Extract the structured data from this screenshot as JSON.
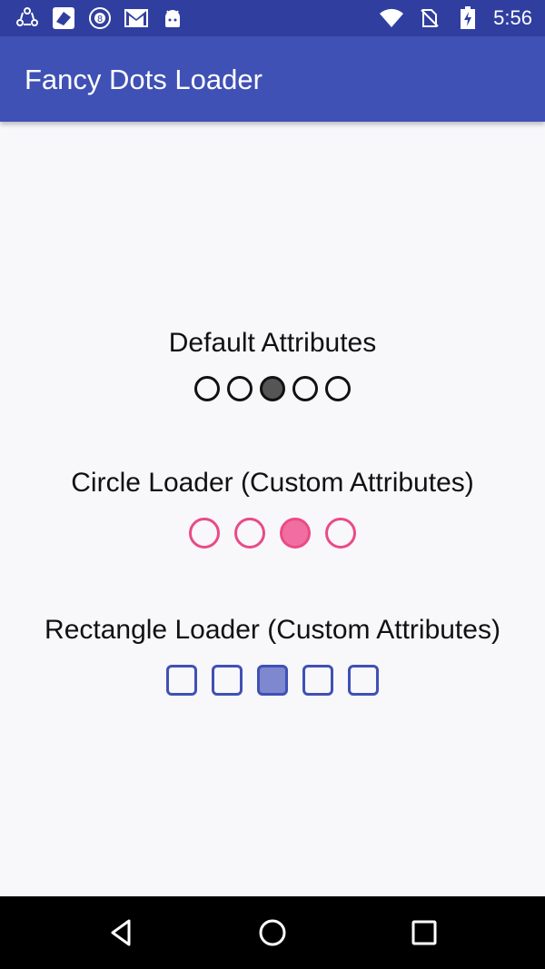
{
  "status_bar": {
    "time": "5:56",
    "left_icons": [
      "sync-icon",
      "app-icon",
      "eight-ball-icon",
      "gmail-icon",
      "android-icon"
    ],
    "right_icons": [
      "wifi-icon",
      "no-sim-icon",
      "battery-charging-icon"
    ]
  },
  "app_bar": {
    "title": "Fancy Dots Loader"
  },
  "sections": [
    {
      "label": "Default Attributes",
      "dot_count": 5,
      "active_index": 2,
      "shape": "circle",
      "color": "#111111",
      "active_fill": "#555555"
    },
    {
      "label": "Circle Loader (Custom Attributes)",
      "dot_count": 4,
      "active_index": 2,
      "shape": "circle",
      "color": "#e94b86",
      "active_fill": "#f06ea1"
    },
    {
      "label": "Rectangle Loader (Custom Attributes)",
      "dot_count": 5,
      "active_index": 2,
      "shape": "rounded-square",
      "color": "#3f51b5",
      "active_fill": "#7d88cf"
    }
  ],
  "nav_bar": {
    "buttons": [
      "back-icon",
      "home-icon",
      "recents-icon"
    ]
  },
  "colors": {
    "status_bar": "#303f9f",
    "app_bar": "#3f51b5",
    "background": "#f8f7fa"
  }
}
